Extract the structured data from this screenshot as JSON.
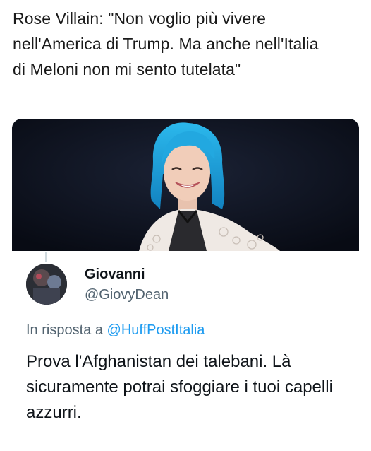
{
  "quoted_post": {
    "text": "Rose Villain: \"Non voglio più vivere nell'America di Trump. Ma anche nell'Italia di Meloni non mi sento tutelata\""
  },
  "media": {
    "icon": "photo-of-woman-with-blue-hair"
  },
  "reply": {
    "author": {
      "display_name": "Giovanni",
      "handle": "@GiovyDean"
    },
    "replying_to_label": "In risposta a",
    "replying_to_handle": "@HuffPostItalia",
    "text": "Prova l'Afghanistan dei talebani. Là sicuramente potrai sfoggiare i tuoi capelli azzurri."
  },
  "colors": {
    "link": "#1d9bf0",
    "secondary_text": "#536471",
    "primary_text": "#0f1419",
    "hair": "#1aa3d9",
    "photo_background": "#0e1322"
  }
}
